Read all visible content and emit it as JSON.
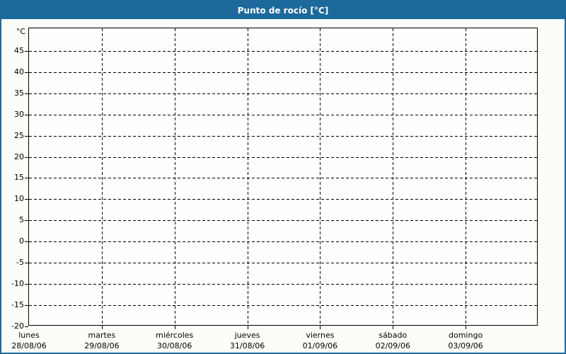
{
  "colors": {
    "titlebar_bg": "#1e699c",
    "titlebar_text": "#ffffff",
    "frame_border": "#1e699c",
    "plot_border": "#000000",
    "grid": "#000000",
    "text": "#000000",
    "page_bg": "#fcfdf8",
    "plot_bg": "#fefefd"
  },
  "chart_data": {
    "type": "line",
    "title": "Punto de rocío [°C]",
    "y_unit_label": "°C",
    "ylim": [
      -20,
      50.3
    ],
    "ytick_step": 5,
    "yticks": [
      45,
      40,
      35,
      30,
      25,
      20,
      15,
      10,
      5,
      0,
      -5,
      -10,
      -15,
      -20
    ],
    "grid": "dashed",
    "legend": "none",
    "x_slots": 7,
    "x_categories": [
      {
        "day": "lunes",
        "date": "28/08/06"
      },
      {
        "day": "martes",
        "date": "29/08/06"
      },
      {
        "day": "miércoles",
        "date": "30/08/06"
      },
      {
        "day": "jueves",
        "date": "31/08/06"
      },
      {
        "day": "viernes",
        "date": "01/09/06"
      },
      {
        "day": "sábado",
        "date": "02/09/06"
      },
      {
        "day": "domingo",
        "date": "03/09/06"
      }
    ],
    "series": []
  }
}
